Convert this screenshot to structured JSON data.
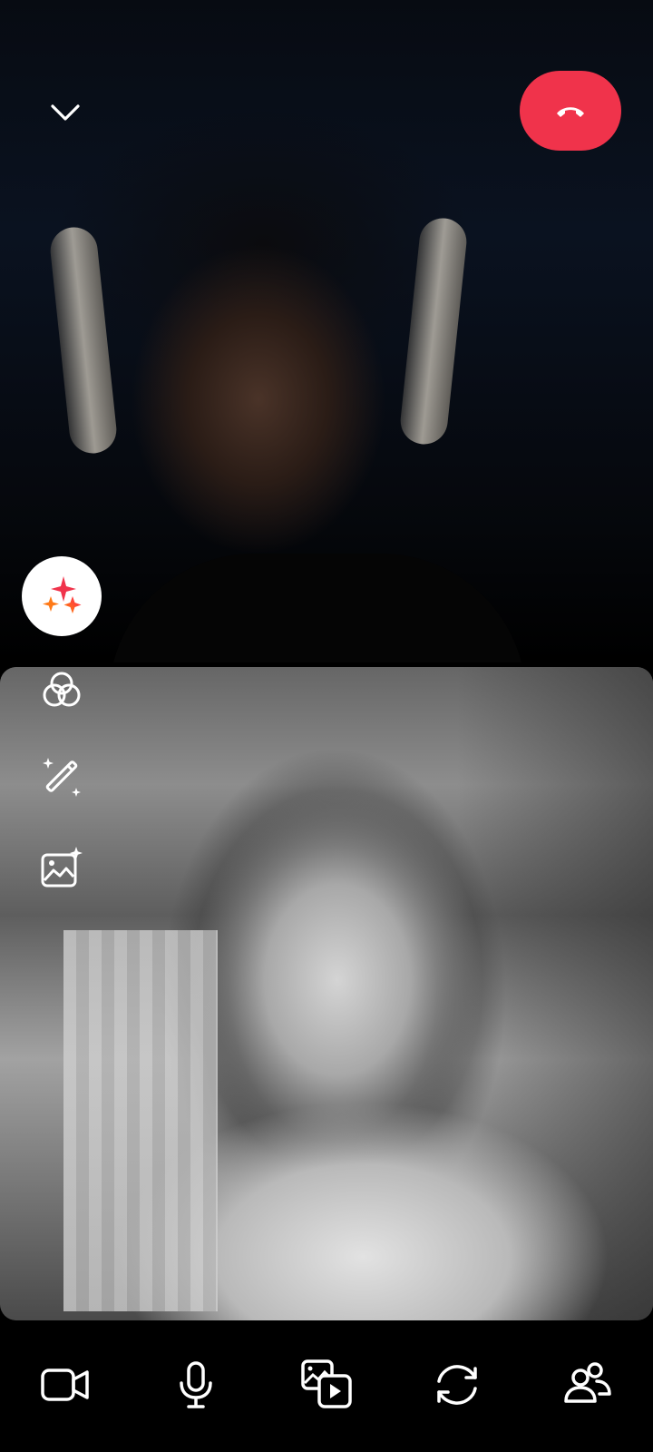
{
  "call": {
    "status_indicator_color": "#2ecc40",
    "end_call_color": "#f0334b"
  },
  "controls": {
    "top": [
      "chevron-down-icon",
      "phone-hangup-icon"
    ],
    "side": [
      "sparkles-icon",
      "filters-icon",
      "magic-wand-icon",
      "image-sparkle-icon"
    ],
    "bottom": [
      "video-camera-icon",
      "microphone-icon",
      "share-media-icon",
      "flip-camera-icon",
      "participants-icon"
    ]
  }
}
